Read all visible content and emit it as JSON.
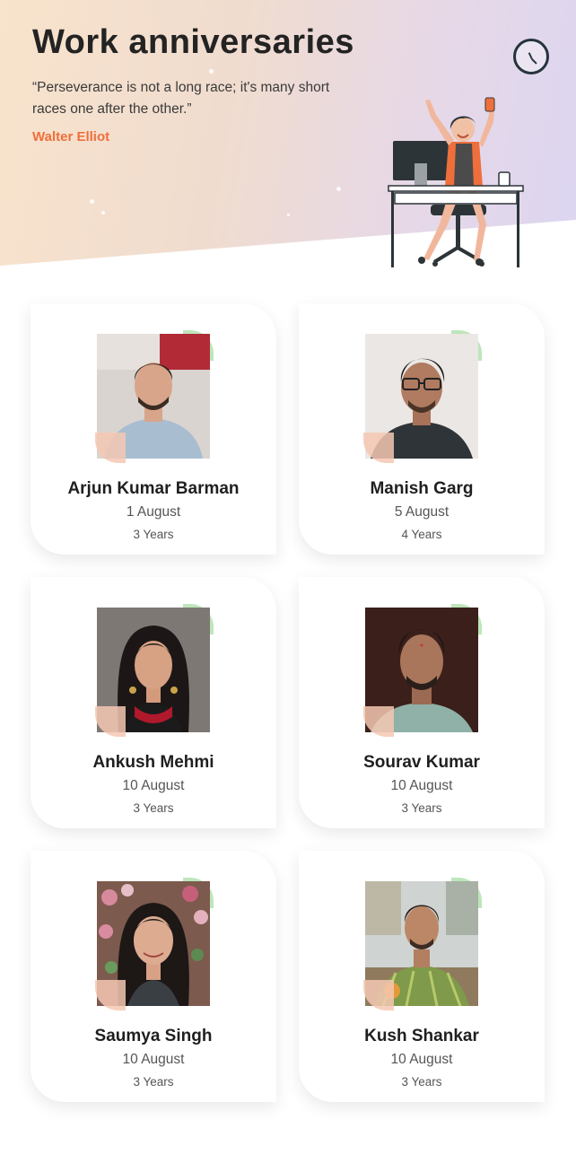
{
  "header": {
    "title": "Work anniversaries",
    "quote": "“Perseverance is not a long race; it's many short races one after the other.”",
    "author": "Walter Elliot"
  },
  "colors": {
    "accent_orange": "#ee6f3b",
    "accent_green": "#bde6bb",
    "accent_peach": "#f4c8b3"
  },
  "employees": [
    {
      "name": "Arjun Kumar Barman",
      "date": "1 August",
      "years": "3 Years"
    },
    {
      "name": "Manish Garg",
      "date": "5 August",
      "years": "4 Years"
    },
    {
      "name": "Ankush Mehmi",
      "date": "10 August",
      "years": "3 Years"
    },
    {
      "name": "Sourav Kumar",
      "date": "10 August",
      "years": "3 Years"
    },
    {
      "name": "Saumya Singh",
      "date": "10 August",
      "years": "3 Years"
    },
    {
      "name": "Kush Shankar",
      "date": "10 August",
      "years": "3 Years"
    }
  ]
}
